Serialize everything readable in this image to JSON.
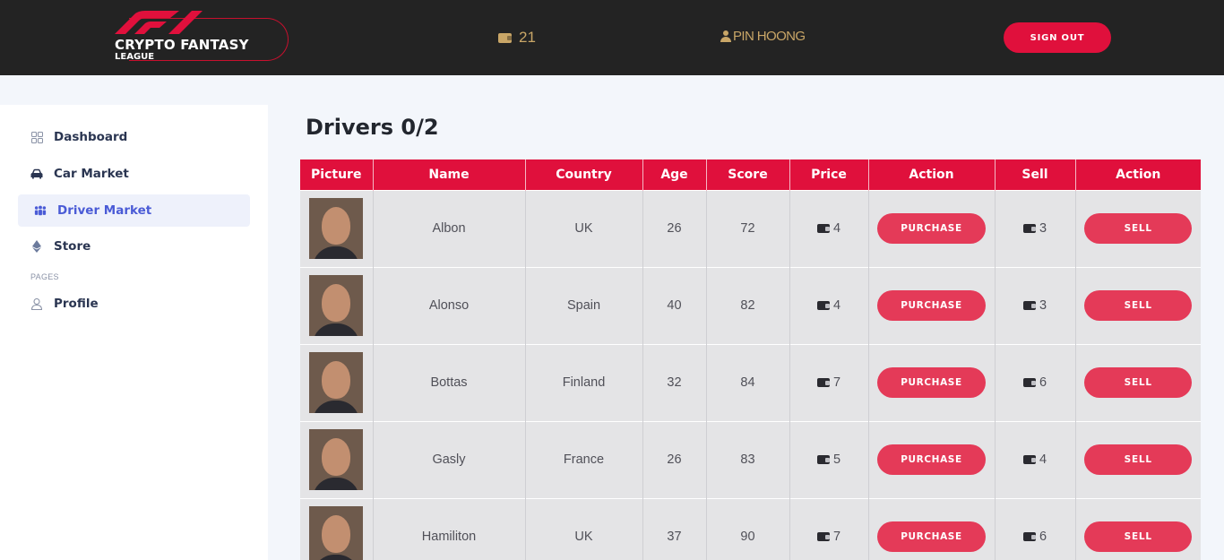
{
  "brand": {
    "title": "CRYPTO FANTASY",
    "subtitle": "LEAGUE"
  },
  "header": {
    "coins": "21",
    "username": "PIN HOONG",
    "signout_label": "SIGN OUT"
  },
  "sidebar": {
    "items": [
      {
        "label": "Dashboard",
        "icon": "grid-icon"
      },
      {
        "label": "Car Market",
        "icon": "car-icon"
      },
      {
        "label": "Driver Market",
        "icon": "users-icon",
        "active": true
      },
      {
        "label": "Store",
        "icon": "ethereum-icon"
      }
    ],
    "section_label": "PAGES",
    "pages": [
      {
        "label": "Profile",
        "icon": "user-icon"
      }
    ]
  },
  "main": {
    "title": "Drivers 0/2",
    "columns": [
      "Picture",
      "Name",
      "Country",
      "Age",
      "Score",
      "Price",
      "Action",
      "Sell",
      "Action"
    ],
    "purchase_label": "PURCHASE",
    "sell_label": "SELL",
    "rows": [
      {
        "name": "Albon",
        "country": "UK",
        "age": "26",
        "score": "72",
        "price": "4",
        "sell": "3"
      },
      {
        "name": "Alonso",
        "country": "Spain",
        "age": "40",
        "score": "82",
        "price": "4",
        "sell": "3"
      },
      {
        "name": "Bottas",
        "country": "Finland",
        "age": "32",
        "score": "84",
        "price": "7",
        "sell": "6"
      },
      {
        "name": "Gasly",
        "country": "France",
        "age": "26",
        "score": "83",
        "price": "5",
        "sell": "4"
      },
      {
        "name": "Hamiliton",
        "country": "UK",
        "age": "37",
        "score": "90",
        "price": "7",
        "sell": "6"
      }
    ]
  },
  "colors": {
    "accent": "#e0103c",
    "button": "#e43a58",
    "gold": "#c9a667",
    "topbar": "#232323"
  }
}
